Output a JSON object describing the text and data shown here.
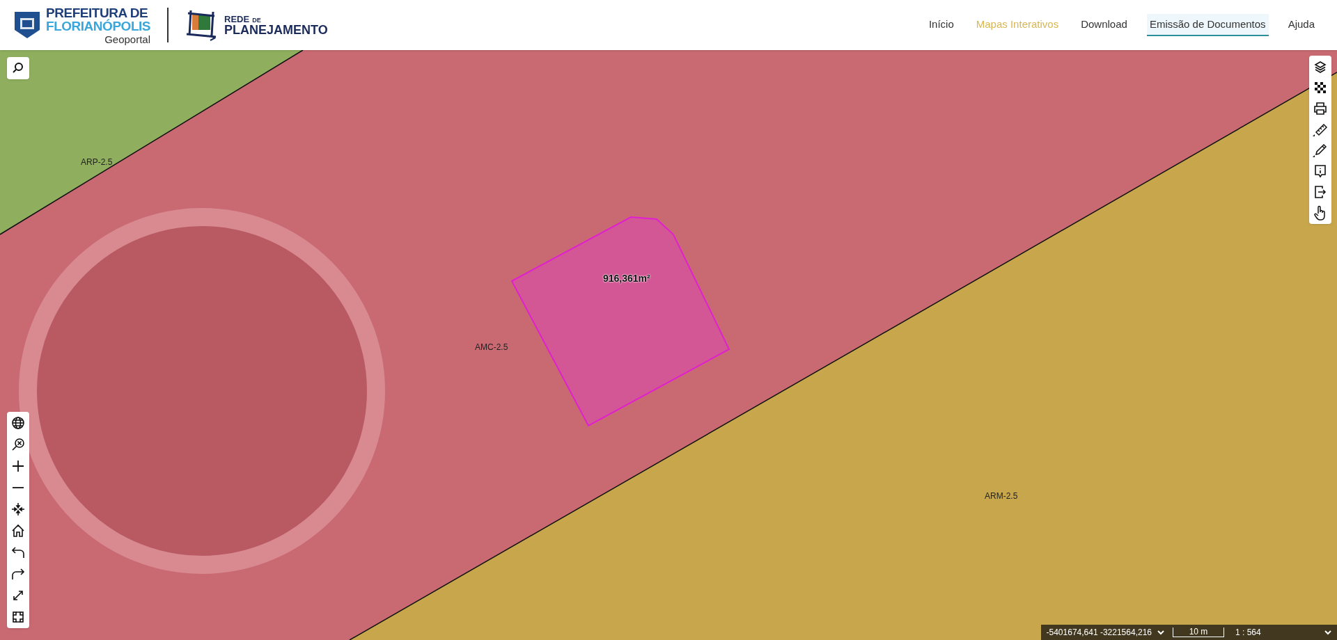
{
  "header": {
    "logo_title_1": "PREFEITURA DE",
    "logo_title_2": "FLORIANÓPOLIS",
    "logo_subtitle": "Geoportal",
    "partner_small": "REDE",
    "partner_de": "DE",
    "partner_big": "PLANEJAMENTO"
  },
  "nav": [
    {
      "label": "Início",
      "selected": false,
      "hovered": false
    },
    {
      "label": "Mapas Interativos",
      "selected": true,
      "hovered": false
    },
    {
      "label": "Download",
      "selected": false,
      "hovered": false
    },
    {
      "label": "Emissão de Documentos",
      "selected": false,
      "hovered": true
    },
    {
      "label": "Ajuda",
      "selected": false,
      "hovered": false
    }
  ],
  "map": {
    "zones": [
      {
        "label": "ARP-2.5",
        "color": "#8fae5e"
      },
      {
        "label": "AMC-2.5",
        "color": "#c96a72"
      },
      {
        "label": "ARM-2.5",
        "color": "#c8a64c"
      }
    ],
    "lot_area": "916,361m²"
  },
  "status_bar": {
    "coordinates": "-5401674,641 -3221564,216",
    "scale_bar": "10 m",
    "scale": "1 : 564"
  }
}
